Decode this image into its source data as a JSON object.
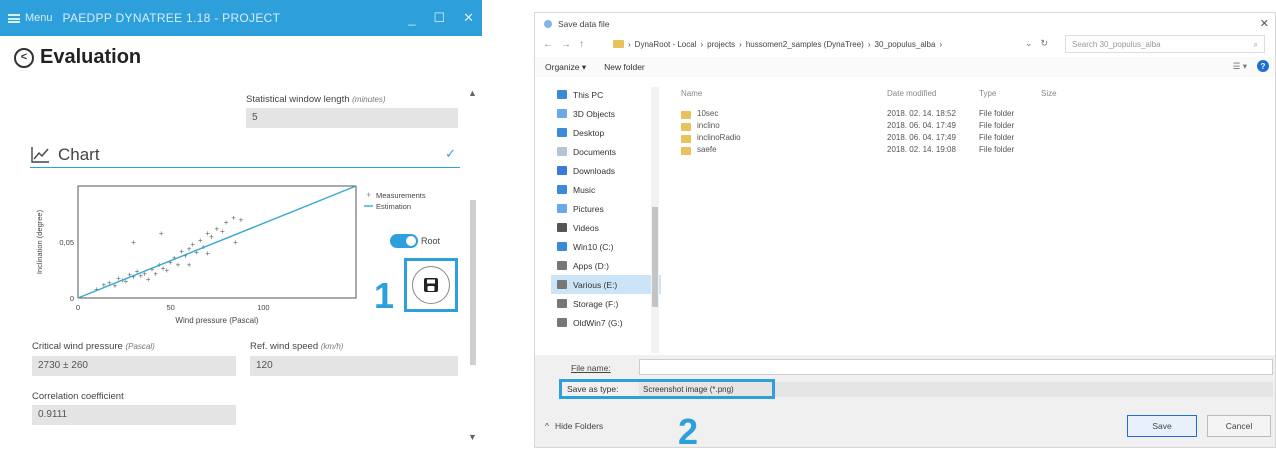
{
  "app": {
    "menu_label": "Menu",
    "title": "PAEDPP DYNATREE 1.18 - PROJECT",
    "controls": [
      "_",
      "☐",
      "✕"
    ],
    "accent_color": "#2d9fdb",
    "page_title": "Evaluation",
    "statistical_window": {
      "label": "Statistical window length",
      "unit": "(minutes)",
      "value": "5"
    },
    "chart_section_title": "Chart",
    "toggle_label": "Root",
    "critical_wind_pressure": {
      "label": "Critical wind pressure",
      "unit": "(Pascal)",
      "value": "2730 ± 260"
    },
    "ref_wind_speed": {
      "label": "Ref. wind speed",
      "unit": "(km/h)",
      "value": "120"
    },
    "correlation": {
      "label": "Correlation coefficient",
      "value": "0.9111"
    }
  },
  "chart_data": {
    "type": "scatter",
    "xlabel": "Wind pressure (Pascal)",
    "ylabel": "Inclination (degree)",
    "x_ticks": [
      "0",
      "50",
      "100"
    ],
    "y_ticks": [
      "0",
      "0,05"
    ],
    "xlim": [
      0,
      150
    ],
    "ylim": [
      0,
      0.1
    ],
    "legend": {
      "position": "right",
      "entries": [
        "Measurements",
        "Estimation"
      ]
    },
    "series": [
      {
        "name": "Measurements",
        "points": [
          [
            10,
            0.008
          ],
          [
            14,
            0.012
          ],
          [
            17,
            0.014
          ],
          [
            20,
            0.011
          ],
          [
            22,
            0.018
          ],
          [
            24,
            0.016
          ],
          [
            26,
            0.015
          ],
          [
            28,
            0.021
          ],
          [
            30,
            0.019
          ],
          [
            32,
            0.024
          ],
          [
            34,
            0.02
          ],
          [
            36,
            0.022
          ],
          [
            38,
            0.017
          ],
          [
            40,
            0.026
          ],
          [
            42,
            0.022
          ],
          [
            44,
            0.03
          ],
          [
            46,
            0.027
          ],
          [
            48,
            0.025
          ],
          [
            50,
            0.032
          ],
          [
            52,
            0.036
          ],
          [
            54,
            0.03
          ],
          [
            56,
            0.042
          ],
          [
            58,
            0.038
          ],
          [
            60,
            0.044
          ],
          [
            62,
            0.048
          ],
          [
            64,
            0.041
          ],
          [
            66,
            0.052
          ],
          [
            68,
            0.046
          ],
          [
            70,
            0.058
          ],
          [
            72,
            0.055
          ],
          [
            75,
            0.062
          ],
          [
            78,
            0.06
          ],
          [
            80,
            0.068
          ],
          [
            84,
            0.072
          ],
          [
            88,
            0.07
          ],
          [
            45,
            0.058
          ],
          [
            30,
            0.05
          ],
          [
            60,
            0.03
          ],
          [
            70,
            0.04
          ],
          [
            85,
            0.05
          ]
        ]
      },
      {
        "name": "Estimation",
        "line": [
          [
            0,
            0.0
          ],
          [
            150,
            0.1
          ]
        ]
      }
    ]
  },
  "callouts": {
    "one": "1",
    "two": "2"
  },
  "dialog": {
    "title": "Save data file",
    "close": "✕",
    "nav_arrows": [
      "←",
      "→",
      "↑"
    ],
    "breadcrumb": [
      "DynaRoot - Local",
      "projects",
      "hussomen2_samples (DynaTree)",
      "30_populus_alba"
    ],
    "search_placeholder": "Search 30_populus_alba",
    "organize": "Organize ▾",
    "new_folder": "New folder",
    "help": "?",
    "nav_items": [
      {
        "label": "This PC",
        "color": "#3a8ad8"
      },
      {
        "label": "3D Objects",
        "color": "#6aa8e8"
      },
      {
        "label": "Desktop",
        "color": "#3a8ad8"
      },
      {
        "label": "Documents",
        "color": "#b5c4d6"
      },
      {
        "label": "Downloads",
        "color": "#3a7ad8"
      },
      {
        "label": "Music",
        "color": "#3a8ad8"
      },
      {
        "label": "Pictures",
        "color": "#6aa8e8"
      },
      {
        "label": "Videos",
        "color": "#555555"
      },
      {
        "label": "Win10 (C:)",
        "color": "#3a8ad8"
      },
      {
        "label": "Apps (D:)",
        "color": "#777777"
      },
      {
        "label": "Various (E:)",
        "color": "#777777",
        "selected": true
      },
      {
        "label": "Storage (F:)",
        "color": "#777777"
      },
      {
        "label": "OldWin7 (G:)",
        "color": "#777777"
      }
    ],
    "columns": [
      "Name",
      "Date modified",
      "Type",
      "Size"
    ],
    "files": [
      {
        "name": "10sec",
        "date": "2018. 02. 14. 18:52",
        "type": "File folder"
      },
      {
        "name": "inclino",
        "date": "2018. 06. 04. 17:49",
        "type": "File folder"
      },
      {
        "name": "inclinoRadio",
        "date": "2018. 06. 04. 17:49",
        "type": "File folder"
      },
      {
        "name": "saefe",
        "date": "2018. 02. 14. 19:08",
        "type": "File folder"
      }
    ],
    "file_name_label": "File name:",
    "file_name_value": "",
    "save_as_type_label": "Save as type:",
    "save_as_type_value": "Screenshot image (*.png)",
    "hide_folders": "Hide Folders",
    "save": "Save",
    "cancel": "Cancel"
  }
}
